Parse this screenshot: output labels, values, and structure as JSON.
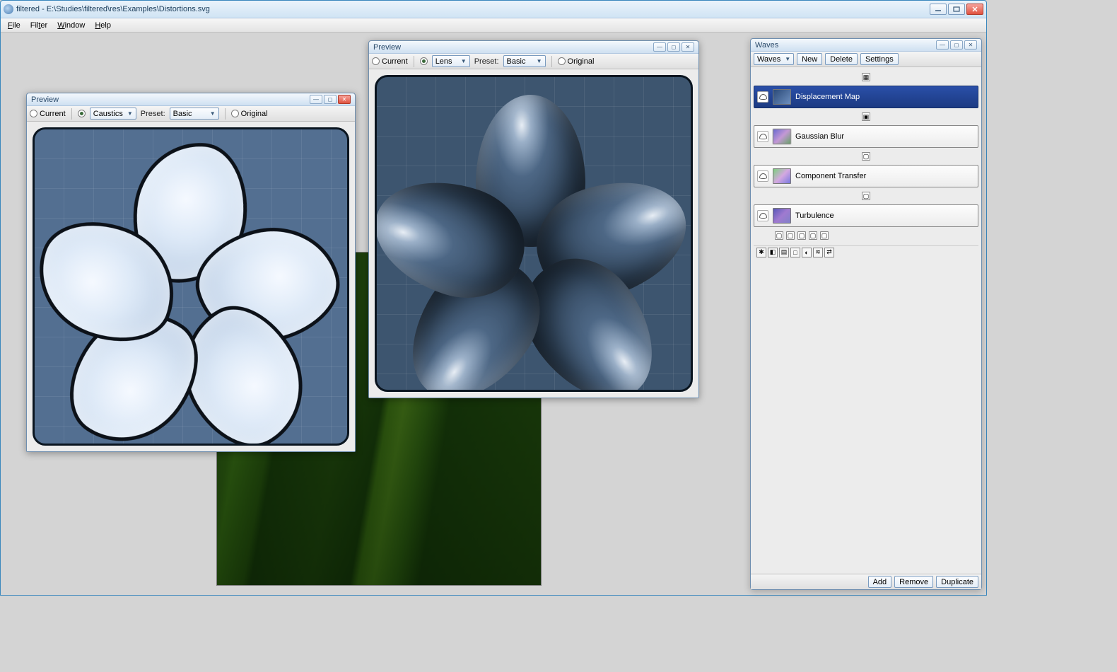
{
  "window": {
    "title": "filtered - E:\\Studies\\filtered\\res\\Examples\\Distortions.svg"
  },
  "menu": {
    "file": "File",
    "filter": "Filter",
    "window": "Window",
    "help": "Help"
  },
  "preview1": {
    "title": "Preview",
    "current": "Current",
    "filter_selected": "Caustics",
    "preset_label": "Preset:",
    "preset_selected": "Basic",
    "original": "Original"
  },
  "preview2": {
    "title": "Preview",
    "current": "Current",
    "filter_selected": "Lens",
    "preset_label": "Preset:",
    "preset_selected": "Basic",
    "original": "Original"
  },
  "waves": {
    "title": "Waves",
    "filter_selected": "Waves",
    "new": "New",
    "delete": "Delete",
    "settings": "Settings",
    "nodes": {
      "displacement": "Displacement Map",
      "gaussian": "Gaussian Blur",
      "component": "Component Transfer",
      "turbulence": "Turbulence"
    },
    "add": "Add",
    "remove": "Remove",
    "duplicate": "Duplicate"
  }
}
